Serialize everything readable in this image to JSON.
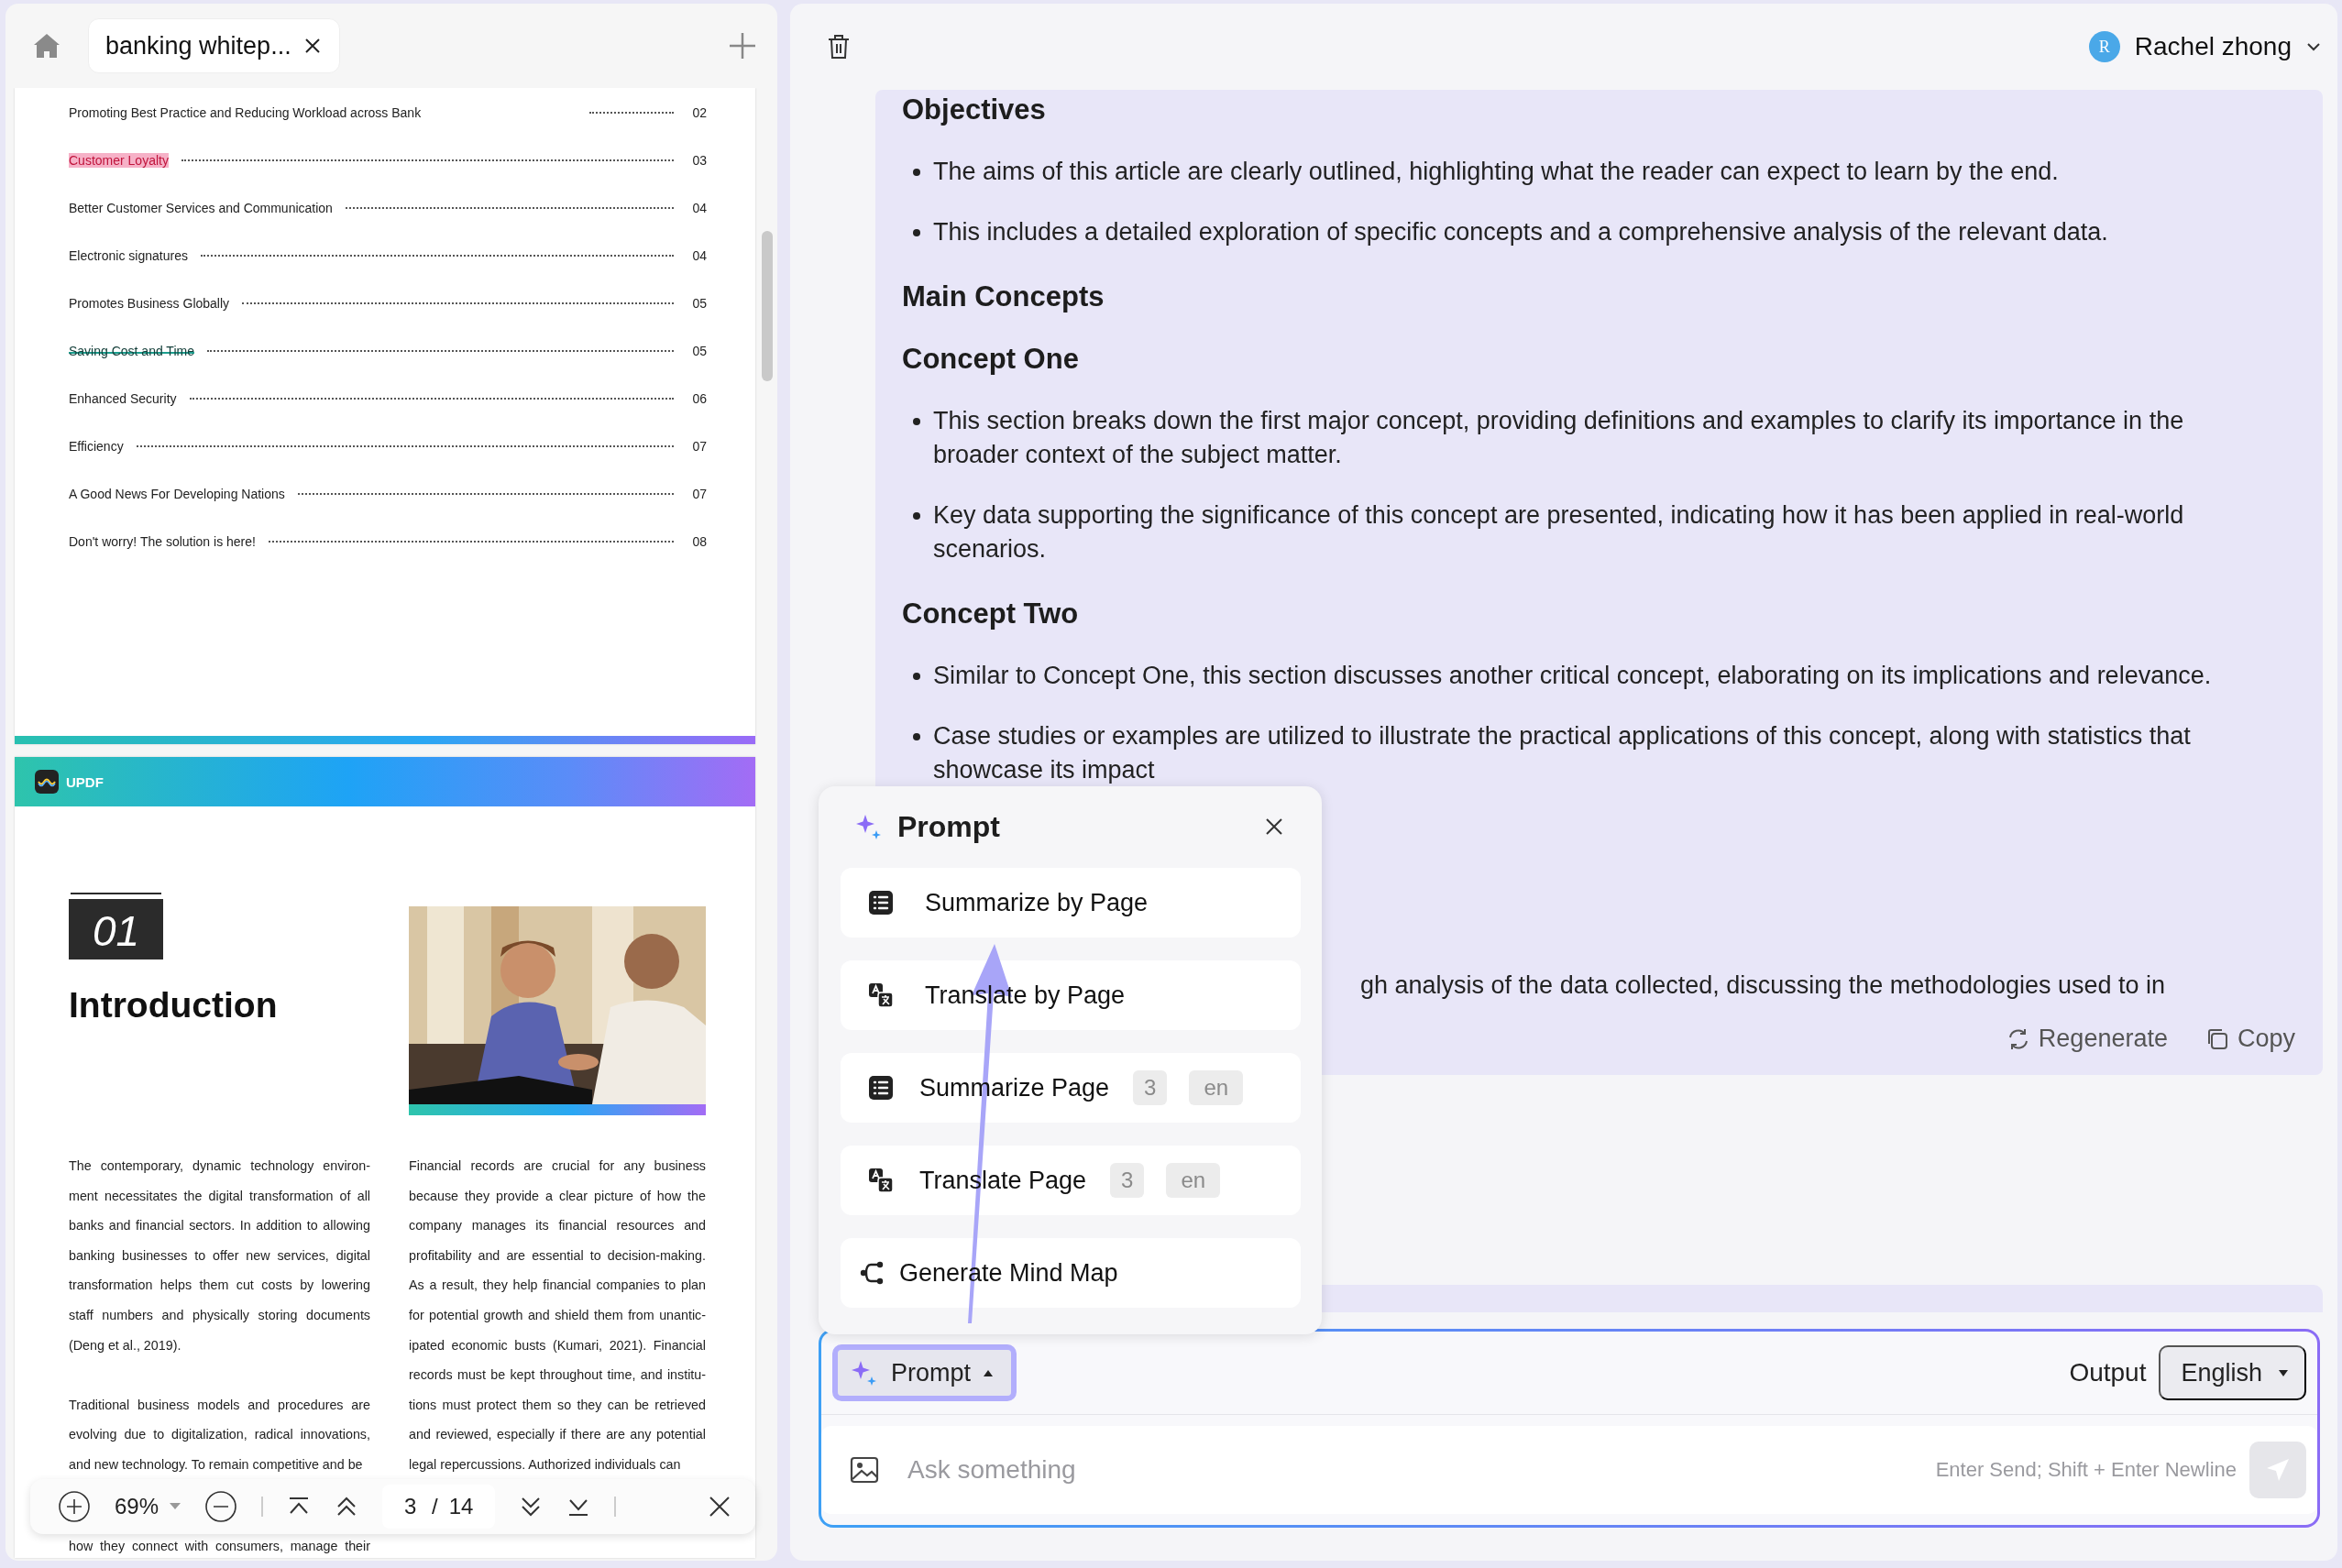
{
  "tab": {
    "title": "banking whitep..."
  },
  "toc": [
    {
      "title": "Promoting Best Practice and Reducing Workload across Bank",
      "page": "02",
      "kind": "plain"
    },
    {
      "title": "Customer Loyalty",
      "page": "03",
      "kind": "highlight"
    },
    {
      "title": "Better Customer Services and Communication",
      "page": "04",
      "kind": "plain"
    },
    {
      "title": "Electronic signatures",
      "page": "04",
      "kind": "plain"
    },
    {
      "title": "Promotes Business Globally",
      "page": "05",
      "kind": "plain"
    },
    {
      "title": "Saving Cost and Time",
      "page": "05",
      "kind": "strikeout"
    },
    {
      "title": "Enhanced Security",
      "page": "06",
      "kind": "plain"
    },
    {
      "title": "Efficiency",
      "page": "07",
      "kind": "plain"
    },
    {
      "title": "A Good News For Developing Nations",
      "page": "07",
      "kind": "plain"
    },
    {
      "title": "Don't worry! The solution is here!",
      "page": "08",
      "kind": "plain"
    }
  ],
  "page": {
    "brand": "UPDF",
    "number": "01",
    "heading": "Introduction",
    "left_column": [
      [
        "The contemporary, dynamic technology environ-",
        "ment necessitates the digital transformation of all",
        "banks and financial sectors. In addition to allowing",
        "banking businesses to offer new services, digital",
        "transformation helps them cut costs by lowering",
        "staff numbers and physically storing documents",
        "(Deng et al., 2019)."
      ],
      [
        "Traditional business models and procedures are",
        "evolving due to digitalization, radical innovations,",
        "and new technology. To remain competitive and be"
      ]
    ],
    "right_column": [
      [
        "Financial records are crucial for any business",
        "because they provide a clear picture of how the",
        "company manages its financial resources and",
        "profitability and are essential to decision-making.",
        "As a result, they help financial companies to plan",
        "for potential growth and shield them from unantic-",
        "ipated economic busts (Kumari, 2021). Financial",
        "records must be kept throughout time, and institu-",
        "tions must protect them so they can be retrieved",
        "and reviewed, especially if there are any potential",
        "legal repercussions. Authorized individuals can"
      ]
    ],
    "after_toolbar": "how they connect with consumers, manage their"
  },
  "viewer_toolbar": {
    "zoom": "69%",
    "page_current": "3",
    "page_separator": "/",
    "page_total": "14"
  },
  "user": {
    "initial": "R",
    "name": "Rachel zhong"
  },
  "message": {
    "blocks": [
      {
        "kind": "heading",
        "text": "Objectives"
      },
      {
        "kind": "bullet",
        "text": "The aims of this article are clearly outlined, highlighting what the reader can expect to learn by the end."
      },
      {
        "kind": "bullet",
        "text": "This includes a detailed exploration of specific concepts and a comprehensive analysis of the relevant data."
      },
      {
        "kind": "heading",
        "text": "Main Concepts"
      },
      {
        "kind": "heading",
        "text": "Concept One"
      },
      {
        "kind": "bullet",
        "text": "This section breaks down the first major concept, providing definitions and examples to clarify its importance in the broader context of the subject matter."
      },
      {
        "kind": "bullet",
        "text": "Key data supporting the significance of this concept are presented, indicating how it has been applied in real-world scenarios."
      },
      {
        "kind": "heading",
        "text": "Concept Two"
      },
      {
        "kind": "bullet",
        "text": "Similar to Concept One, this section discusses another critical concept, elaborating on its implications and relevance."
      },
      {
        "kind": "bullet",
        "text": "Case studies or examples are utilized to illustrate the practical applications of this concept, along with statistics that showcase its impact"
      },
      {
        "kind": "fragment",
        "text": "gh analysis of the data collected, discussing the methodologies used to in"
      }
    ],
    "actions": [
      {
        "kind": "regenerate",
        "label": "Regenerate"
      },
      {
        "kind": "copy",
        "label": "Copy"
      }
    ]
  },
  "prompt_menu": {
    "title": "Prompt",
    "items": [
      {
        "kind": "list",
        "label": "Summarize by Page"
      },
      {
        "kind": "translate",
        "label": "Translate by Page"
      },
      {
        "kind": "list",
        "label": "Summarize Page",
        "page": "3",
        "language": "en"
      },
      {
        "kind": "translate",
        "label": "Translate Page",
        "page": "3",
        "language": "en"
      },
      {
        "kind": "mindmap",
        "label": "Generate Mind Map"
      }
    ]
  },
  "composer": {
    "prompt_button": "Prompt",
    "output_label": "Output",
    "language": "English",
    "placeholder": "Ask something",
    "hint": "Enter Send; Shift + Enter Newline"
  }
}
